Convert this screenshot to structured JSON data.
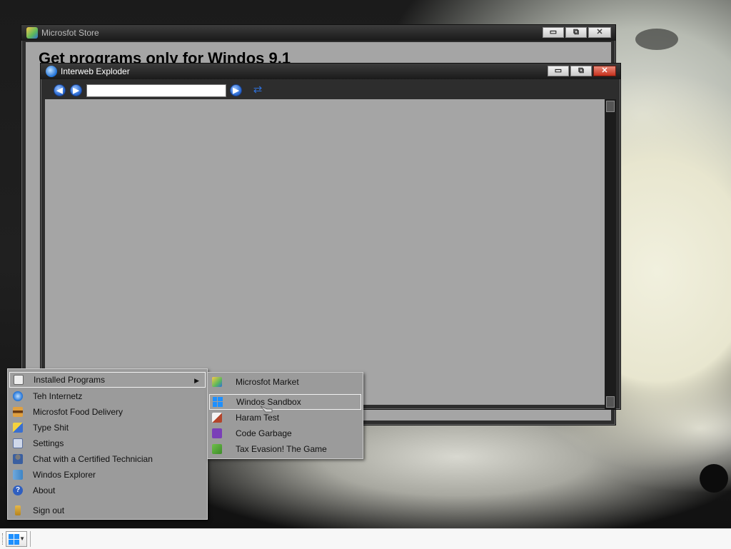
{
  "store_window": {
    "title": "Microsfot Store",
    "heading": "Get programs only for Windos 9.1",
    "controls": {
      "minimize": "▭",
      "maximize": "⧉",
      "close": "✕"
    }
  },
  "browser_window": {
    "title": "Interweb Exploder",
    "url_value": "",
    "controls": {
      "minimize": "▭",
      "maximize": "⧉",
      "close": "✕"
    }
  },
  "start_menu": {
    "items": [
      {
        "label": "Installed Programs",
        "icon": "apps-grid-icon",
        "has_submenu": true,
        "selected": true
      },
      {
        "label": "Teh Internetz",
        "icon": "internet-explorer-icon"
      },
      {
        "label": "Microsfot Food Delivery",
        "icon": "burger-icon"
      },
      {
        "label": "Type Shit",
        "icon": "notepad-icon"
      },
      {
        "label": "Settings",
        "icon": "settings-icon"
      },
      {
        "label": "Chat with a Certified Technician",
        "icon": "technician-icon"
      },
      {
        "label": "Windos Explorer",
        "icon": "folder-icon"
      },
      {
        "label": "About",
        "icon": "help-icon"
      },
      {
        "label": "Sign out",
        "icon": "key-icon"
      }
    ]
  },
  "submenu": {
    "items": [
      {
        "label": "Microsfot Market",
        "icon": "market-icon"
      },
      {
        "label": "Windos Sandbox",
        "icon": "windows-logo-icon",
        "selected": true
      },
      {
        "label": "Haram Test",
        "icon": "paint-brush-icon"
      },
      {
        "label": "Code Garbage",
        "icon": "visual-studio-icon"
      },
      {
        "label": "Tax Evasion! The Game",
        "icon": "money-icon"
      }
    ]
  },
  "colors": {
    "window_frame": "#2d2d2d",
    "window_content": "#a5a5a5",
    "menu_bg": "#9b9b9b",
    "accent_blue": "#1e90ff",
    "close_red": "#c5301c"
  }
}
